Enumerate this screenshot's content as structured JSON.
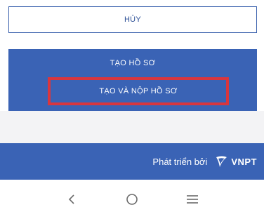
{
  "buttons": {
    "cancel": "HỦY",
    "create": "TẠO HỒ SƠ",
    "create_and_submit": "TẠO VÀ NỘP HỒ SƠ"
  },
  "footer": {
    "developed_by": "Phát triển bởi",
    "brand": "VNPT"
  },
  "nav": {
    "back_icon": "chevron-left-icon",
    "home_icon": "circle-home-icon",
    "menu_icon": "hamburger-menu-icon"
  },
  "colors": {
    "primary": "#3a63b5",
    "highlight": "#d9363e",
    "strip": "#f3f3f5"
  }
}
